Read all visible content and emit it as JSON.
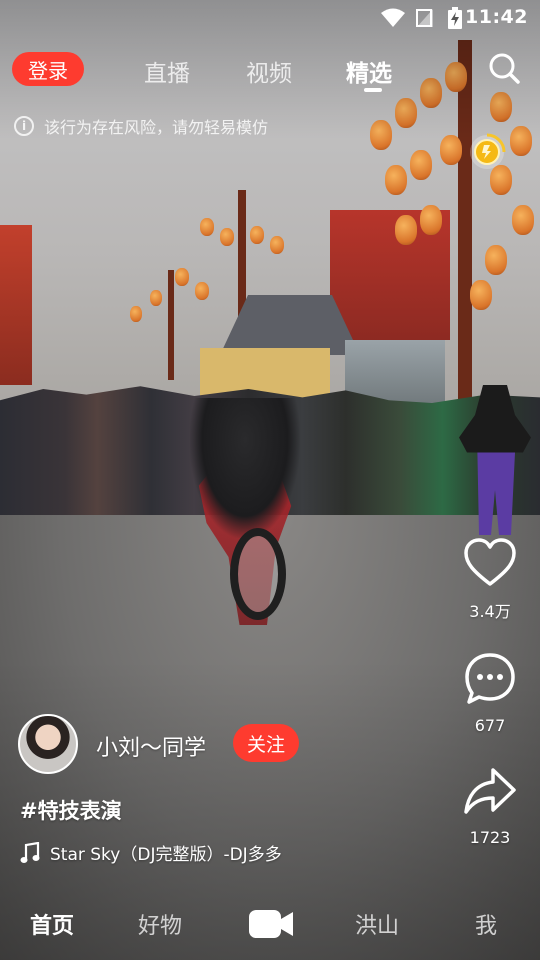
{
  "status_bar": {
    "time": "11:42"
  },
  "top_bar": {
    "login_label": "登录",
    "tabs": [
      {
        "label": "直播",
        "active": false
      },
      {
        "label": "视频",
        "active": false
      },
      {
        "label": "精选",
        "active": true
      }
    ]
  },
  "warning_text": "该行为存在风险，请勿轻易模仿",
  "actions": {
    "like_count": "3.4万",
    "comment_count": "677",
    "share_count": "1723"
  },
  "author": {
    "name": "小刘～同学",
    "follow_label": "关注"
  },
  "hashtag": "#特技表演",
  "music": "Star Sky（DJ完整版）-DJ多多",
  "bottom_nav": {
    "items": [
      {
        "label": "首页",
        "active": true
      },
      {
        "label": "好物",
        "active": false
      },
      {
        "label": "洪山",
        "active": false
      },
      {
        "label": "我",
        "active": false
      }
    ]
  },
  "colors": {
    "accent": "#fe3b2f"
  }
}
